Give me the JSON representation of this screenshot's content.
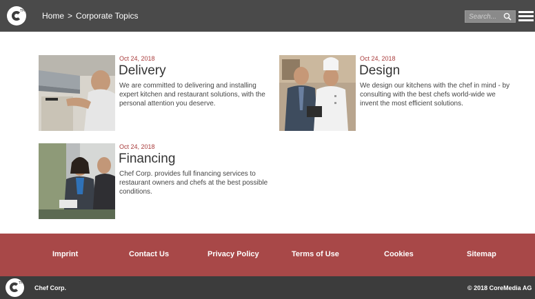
{
  "header": {
    "breadcrumb_home": "Home",
    "breadcrumb_separator": ">",
    "breadcrumb_current": "Corporate Topics",
    "search_placeholder": "Search..."
  },
  "articles": [
    {
      "date": "Oct 24, 2018",
      "title": "Delivery",
      "text": "We are committed to delivering and installing expert kitchen and restaurant solutions, with the personal attention you deserve."
    },
    {
      "date": "Oct 24, 2018",
      "title": "Design",
      "text": "We design our kitchens with the chef in mind - by consulting with the best chefs world-wide we invent the most efficient solutions."
    },
    {
      "date": "Oct 24, 2018",
      "title": "Financing",
      "text": "Chef Corp. provides full financing services to restaurant owners and chefs at the best possible conditions."
    }
  ],
  "footer": {
    "links": [
      "Imprint",
      "Contact Us",
      "Privacy Policy",
      "Terms of Use",
      "Cookies",
      "Sitemap"
    ],
    "brand": "Chef Corp.",
    "copyright": "© 2018 CoreMedia AG"
  },
  "colors": {
    "header_bg": "#4a4a4a",
    "accent_red": "#a84848",
    "date_red": "#a83a3a",
    "bottom_bar_bg": "#3c3c3c"
  },
  "icons": [
    "logo-icon",
    "search-icon",
    "hamburger-menu-icon"
  ]
}
